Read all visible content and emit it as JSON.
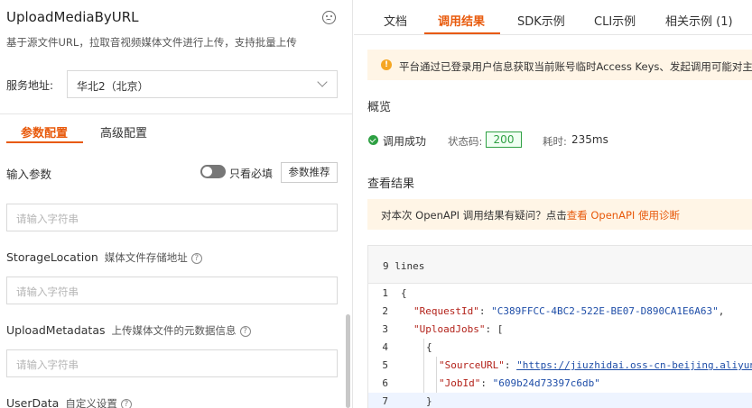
{
  "left": {
    "title": "UploadMediaByURL",
    "description": "基于源文件URL，拉取音视频媒体文件进行上传，支持批量上传",
    "service_label": "服务地址:",
    "service_value": "华北2（北京）",
    "tabs": [
      "参数配置",
      "高级配置"
    ],
    "input_section": {
      "label": "输入参数",
      "toggle_label": "只看必填",
      "recommend_button": "参数推荐"
    },
    "input_placeholder": "请输入字符串",
    "params": [
      {
        "name": "StorageLocation",
        "desc": "媒体文件存储地址"
      },
      {
        "name": "UploadMetadatas",
        "desc": "上传媒体文件的元数据信息"
      },
      {
        "name": "UserData",
        "desc": "自定义设置"
      }
    ],
    "help_glyph": "?"
  },
  "right": {
    "tabs": [
      "文档",
      "调用结果",
      "SDK示例",
      "CLI示例",
      "相关示例 (1)"
    ],
    "notice": "平台通过已登录用户信息获取当前账号临时Access Keys、发起调用可能对主",
    "notice_icon": "!",
    "overview_title": "概览",
    "success_text": "调用成功",
    "status_label": "状态码:",
    "status_code": "200",
    "time_label": "耗时:",
    "time_value": "235ms",
    "result_title": "查看结果",
    "feedback_prefix": "对本次 OpenAPI 调用结果有疑问？点击",
    "feedback_link": "查看 OpenAPI 使用诊断",
    "code": {
      "lines_label": "9 lines",
      "line_numbers": [
        "1",
        "2",
        "3",
        "4",
        "5",
        "6",
        "7"
      ],
      "l1": "{",
      "l2_key": "\"RequestId\"",
      "l2_sep": ": ",
      "l2_val": "\"C389FFCC-4BC2-522E-BE07-D890CA1E6A63\"",
      "l2_end": ",",
      "l3_key": "\"UploadJobs\"",
      "l3_rest": ": [",
      "l4": "{",
      "l5_key": "\"SourceURL\"",
      "l5_sep": ": ",
      "l5_val": "\"https://jiuzhidai.oss-cn-beijing.aliyun",
      "l6_key": "\"JobId\"",
      "l6_sep": ": ",
      "l6_val": "\"609b24d73397c6db\"",
      "l7": "}"
    }
  }
}
